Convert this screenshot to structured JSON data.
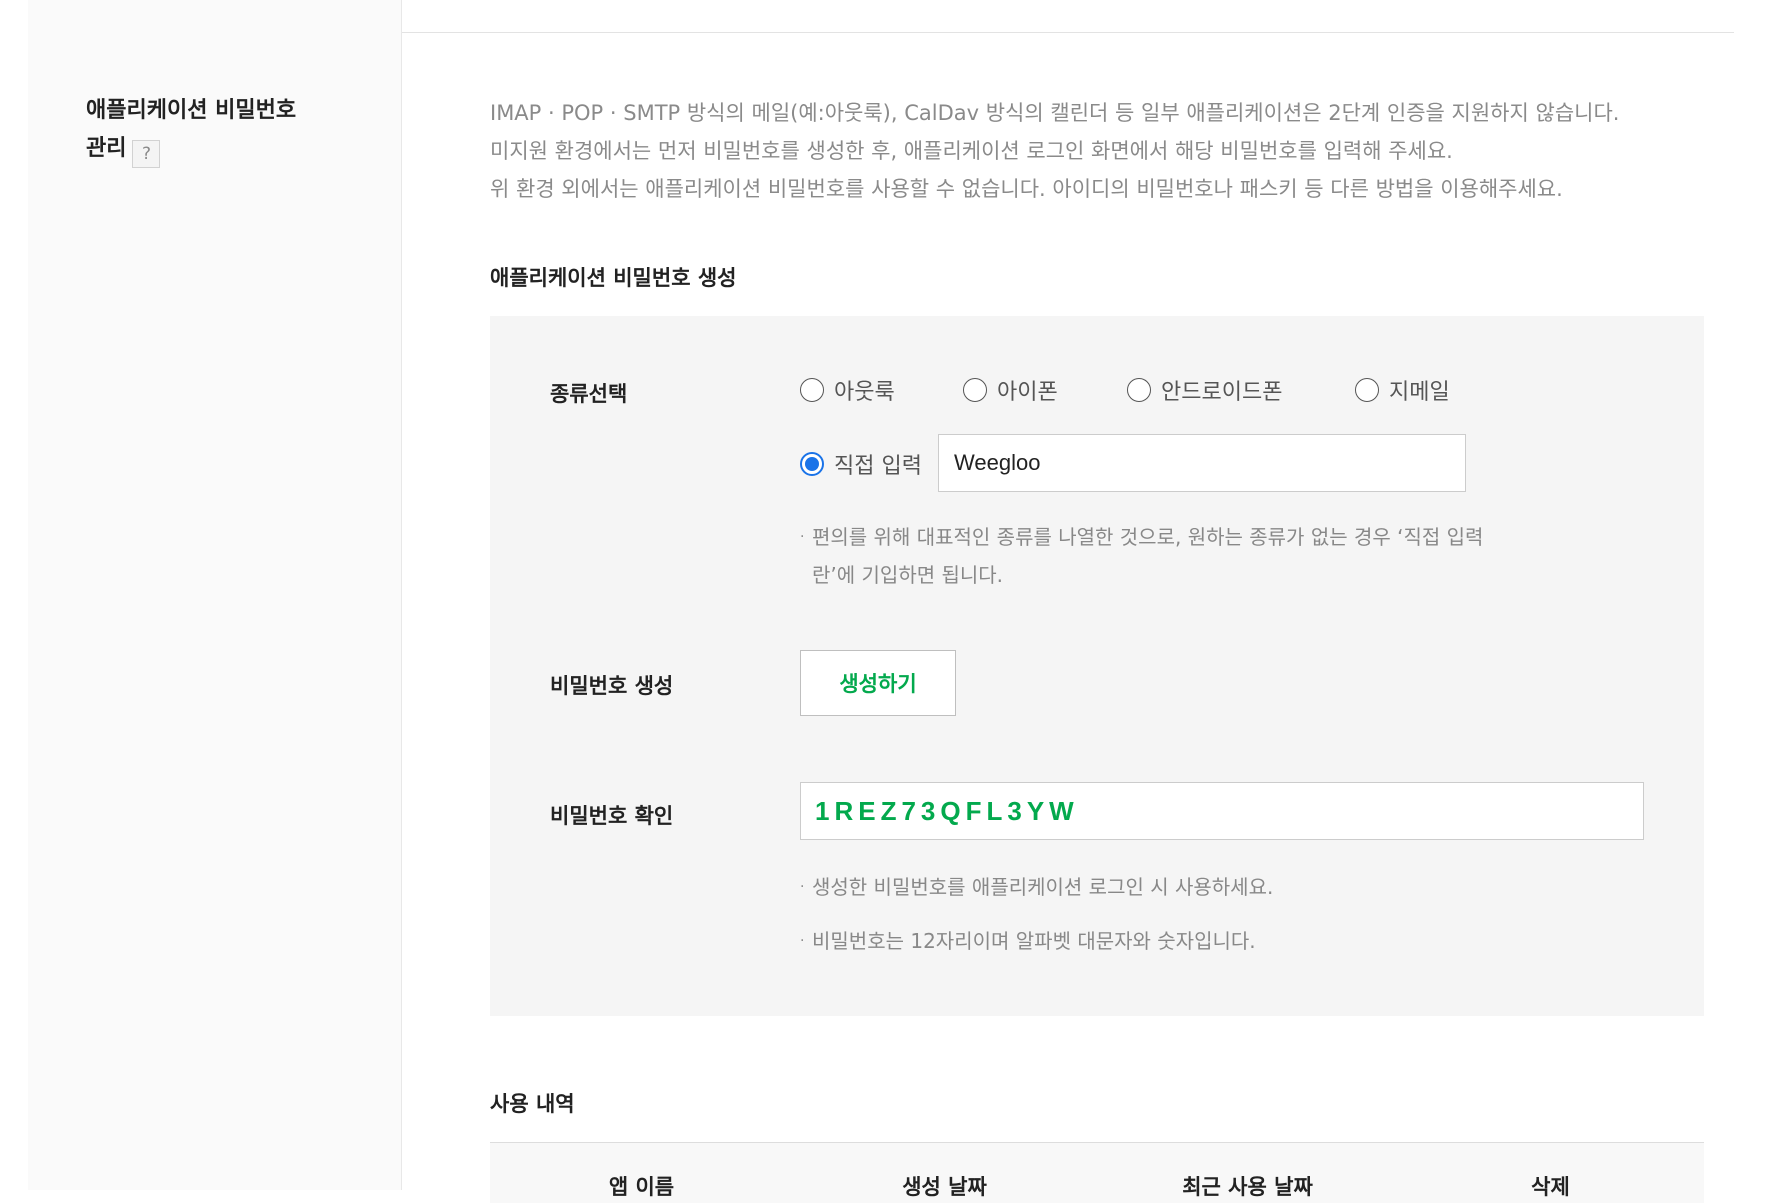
{
  "section": {
    "title_line1": "애플리케이션 비밀번호",
    "title_line2": "관리",
    "help_icon_glyph": "?"
  },
  "description": [
    "IMAP · POP · SMTP 방식의 메일(예:아웃룩), CalDav 방식의 캘린더 등 일부 애플리케이션은 2단계 인증을 지원하지 않습니다.",
    "미지원 환경에서는 먼저 비밀번호를 생성한 후, 애플리케이션 로그인 화면에서 해당 비밀번호를 입력해 주세요.",
    "위 환경 외에서는 애플리케이션 비밀번호를 사용할 수 없습니다. 아이디의 비밀번호나 패스키 등 다른 방법을 이용해주세요."
  ],
  "create": {
    "heading": "애플리케이션 비밀번호 생성",
    "type_label": "종류선택",
    "options": [
      "아웃룩",
      "아이폰",
      "안드로이드폰",
      "지메일"
    ],
    "custom_option": "직접 입력",
    "custom_value": "Weegloo",
    "selected": "직접 입력",
    "type_note_line1": "편의를 위해 대표적인 종류를 나열한 것으로, 원하는 종류가 없는 경우 ‘직접 입력",
    "type_note_line2": "란’에 기입하면 됩니다.",
    "generate_label": "비밀번호 생성",
    "generate_button": "생성하기",
    "confirm_label": "비밀번호 확인",
    "generated_password": "1REZ73QFL3YW",
    "notes": [
      "생성한 비밀번호를 애플리케이션 로그인 시 사용하세요.",
      "비밀번호는 12자리이며 알파벳 대문자와 숫자입니다."
    ]
  },
  "history": {
    "heading": "사용 내역",
    "columns": [
      "앱 이름",
      "생성 날짜",
      "최근 사용 날짜",
      "삭제"
    ]
  },
  "colors": {
    "accent_green": "#03a94d",
    "radio_blue": "#1a73e8"
  }
}
